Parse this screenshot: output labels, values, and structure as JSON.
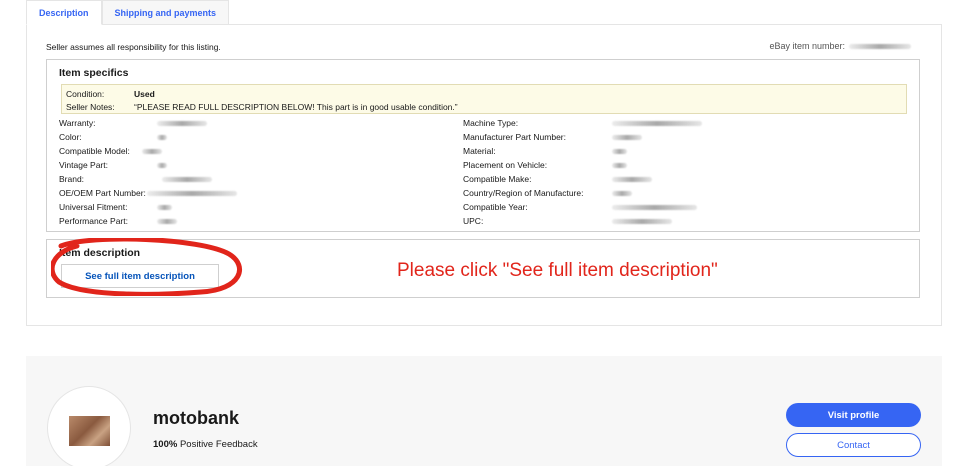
{
  "tabs": [
    {
      "label": "Description",
      "active": true
    },
    {
      "label": "Shipping and payments",
      "active": false
    }
  ],
  "listing": {
    "seller_note": "Seller assumes all responsibility for this listing.",
    "item_number_label": "eBay item number:"
  },
  "item_specifics": {
    "title": "Item specifics",
    "condition_label": "Condition:",
    "condition_value": "Used",
    "seller_notes_label": "Seller Notes:",
    "seller_notes_value": "“PLEASE READ FULL DESCRIPTION BELOW! This part is in good usable condition.”",
    "left": [
      "Warranty:",
      "Color:",
      "Compatible Model:",
      "Vintage Part:",
      "Brand:",
      "OE/OEM Part Number:",
      "Universal Fitment:",
      "Performance Part:"
    ],
    "right": [
      "Machine Type:",
      "Manufacturer Part Number:",
      "Material:",
      "Placement on Vehicle:",
      "Compatible Make:",
      "Country/Region of Manufacture:",
      "Compatible Year:",
      "UPC:"
    ]
  },
  "item_description": {
    "title": "Item description",
    "button_label": "See full item description",
    "annotation": "Please click \"See full item description\""
  },
  "seller": {
    "name": "motobank",
    "feedback_percent": "100%",
    "feedback_label": "Positive Feedback",
    "visit_label": "Visit profile",
    "contact_label": "Contact"
  },
  "colors": {
    "accent": "#3665f3",
    "annotation": "#e1251b"
  }
}
